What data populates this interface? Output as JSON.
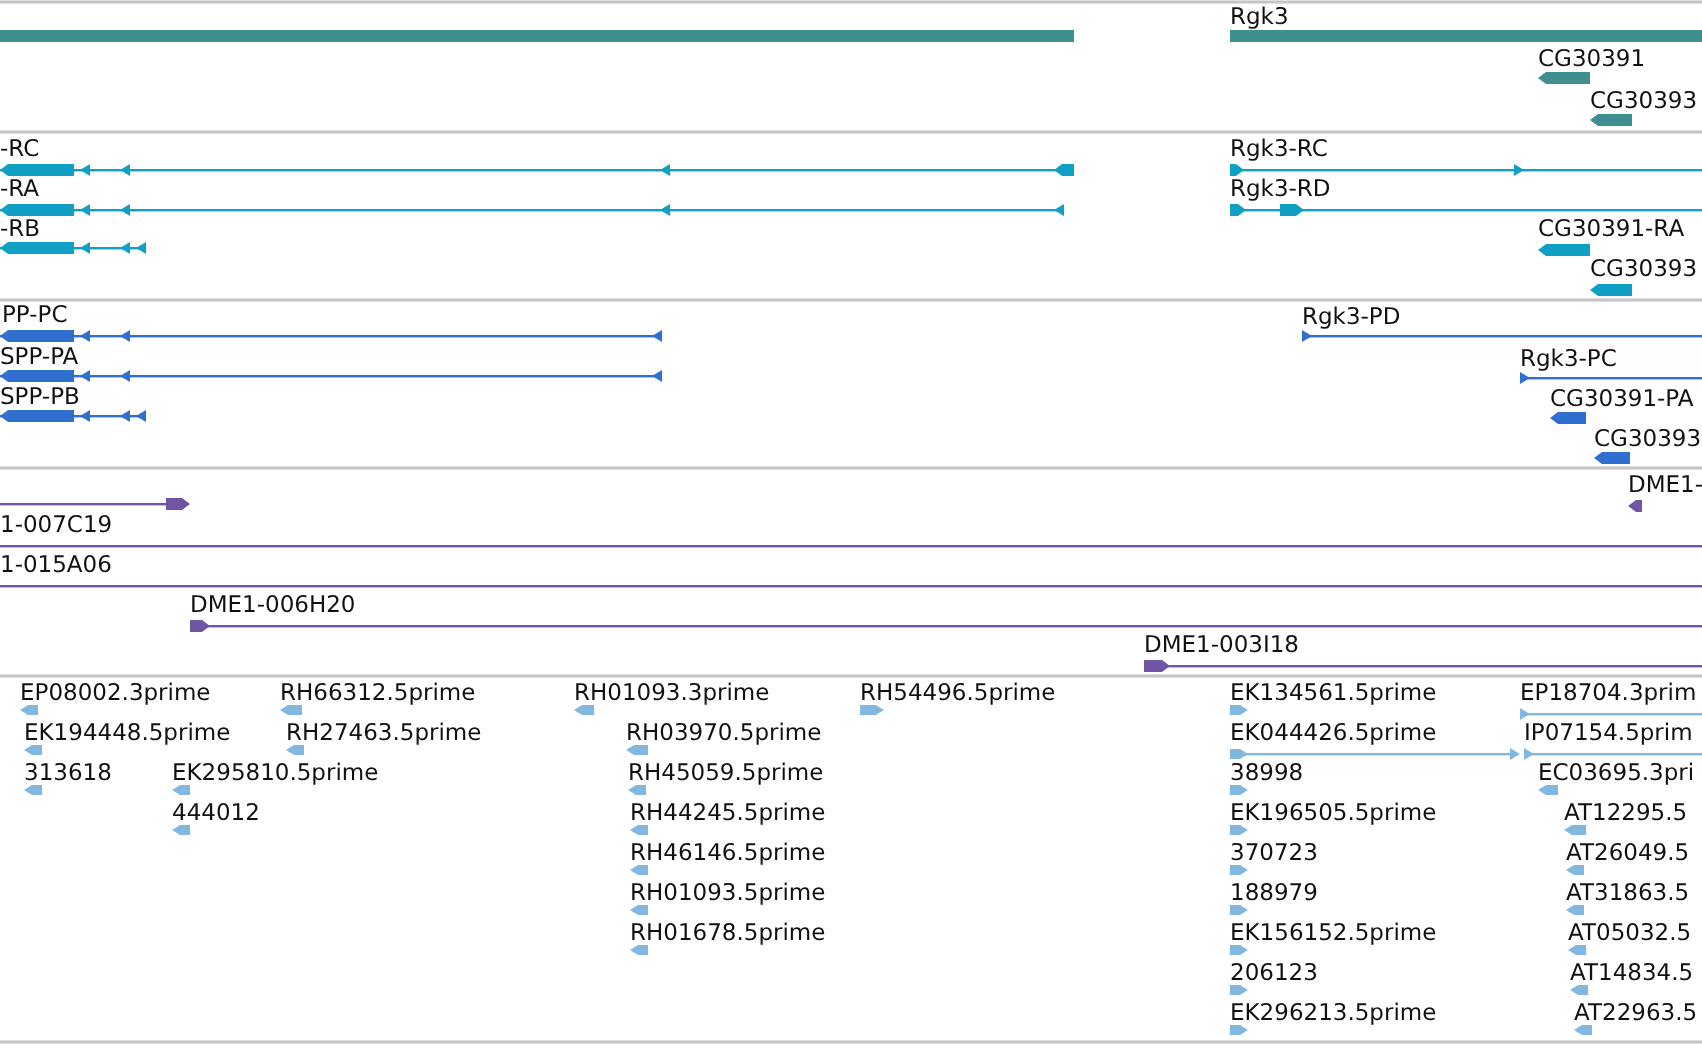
{
  "tracks": [
    {
      "kind": "gene",
      "color": "#3f8f8f",
      "features": [
        {
          "kind": "bar"
        },
        {
          "kind": "bar",
          "label": "Rgk3"
        },
        {
          "kind": "arrow",
          "label": "CG30391",
          "reverse": true
        },
        {
          "kind": "arrow",
          "label": "CG30393",
          "reverse": true
        }
      ]
    },
    {
      "kind": "transcript",
      "color": "#10a0c4",
      "features": [
        {
          "label": "-RC",
          "reverse": true
        },
        {
          "label": "Rgk3-RC",
          "reverse": false
        },
        {
          "label": "-RA",
          "reverse": true
        },
        {
          "label": "Rgk3-RD",
          "reverse": false
        },
        {
          "label": "-RB",
          "reverse": true
        },
        {
          "label": "CG30391-RA",
          "reverse": true
        },
        {
          "label": "CG30393",
          "reverse": true
        }
      ]
    },
    {
      "kind": "protein",
      "color": "#2f6fd0",
      "features": [
        {
          "label": "PP-PC",
          "reverse": true
        },
        {
          "label": "Rgk3-PD",
          "reverse": false
        },
        {
          "label": "SPP-PA",
          "reverse": true
        },
        {
          "label": "Rgk3-PC",
          "reverse": false
        },
        {
          "label": "SPP-PB",
          "reverse": true
        },
        {
          "label": "CG30391-PA",
          "reverse": true
        },
        {
          "label": "CG30393",
          "reverse": true
        }
      ]
    },
    {
      "kind": "clone",
      "color": "#7055a5",
      "features": [
        {
          "reverse": false
        },
        {
          "label": "DME1-",
          "reverse": true
        },
        {
          "label": "1-007C19"
        },
        {
          "label": "1-015A06"
        },
        {
          "label": "DME1-006H20",
          "reverse": false
        },
        {
          "label": "DME1-003I18",
          "reverse": false
        }
      ]
    },
    {
      "kind": "est",
      "color": "#82b8e0",
      "features": [
        {
          "label": "EP08002.3prime",
          "reverse": true
        },
        {
          "label": "RH66312.5prime",
          "reverse": true
        },
        {
          "label": "RH01093.3prime",
          "reverse": true
        },
        {
          "label": "RH54496.5prime",
          "reverse": false
        },
        {
          "label": "EK134561.5prime",
          "reverse": false
        },
        {
          "label": "EP18704.3prim",
          "reverse": false
        },
        {
          "label": "EK194448.5prime",
          "reverse": true
        },
        {
          "label": "RH27463.5prime",
          "reverse": true
        },
        {
          "label": "RH03970.5prime",
          "reverse": true
        },
        {
          "label": "EK044426.5prime",
          "reverse": false
        },
        {
          "label": "IP07154.5prim",
          "reverse": false
        },
        {
          "label": "313618",
          "reverse": true
        },
        {
          "label": "EK295810.5prime",
          "reverse": true
        },
        {
          "label": "RH45059.5prime",
          "reverse": true
        },
        {
          "label": "38998",
          "reverse": false
        },
        {
          "label": "EC03695.3pri",
          "reverse": true
        },
        {
          "label": "444012",
          "reverse": true
        },
        {
          "label": "RH44245.5prime",
          "reverse": true
        },
        {
          "label": "EK196505.5prime",
          "reverse": false
        },
        {
          "label": "AT12295.5",
          "reverse": true
        },
        {
          "label": "RH46146.5prime",
          "reverse": true
        },
        {
          "label": "370723",
          "reverse": false
        },
        {
          "label": "AT26049.5",
          "reverse": true
        },
        {
          "label": "RH01093.5prime",
          "reverse": true
        },
        {
          "label": "188979",
          "reverse": false
        },
        {
          "label": "AT31863.5",
          "reverse": true
        },
        {
          "label": "RH01678.5prime",
          "reverse": true
        },
        {
          "label": "EK156152.5prime",
          "reverse": false
        },
        {
          "label": "AT05032.5",
          "reverse": true
        },
        {
          "label": "206123",
          "reverse": false
        },
        {
          "label": "AT14834.5",
          "reverse": true
        },
        {
          "label": "EK296213.5prime",
          "reverse": false
        },
        {
          "label": "AT22963.5",
          "reverse": true
        }
      ]
    }
  ]
}
